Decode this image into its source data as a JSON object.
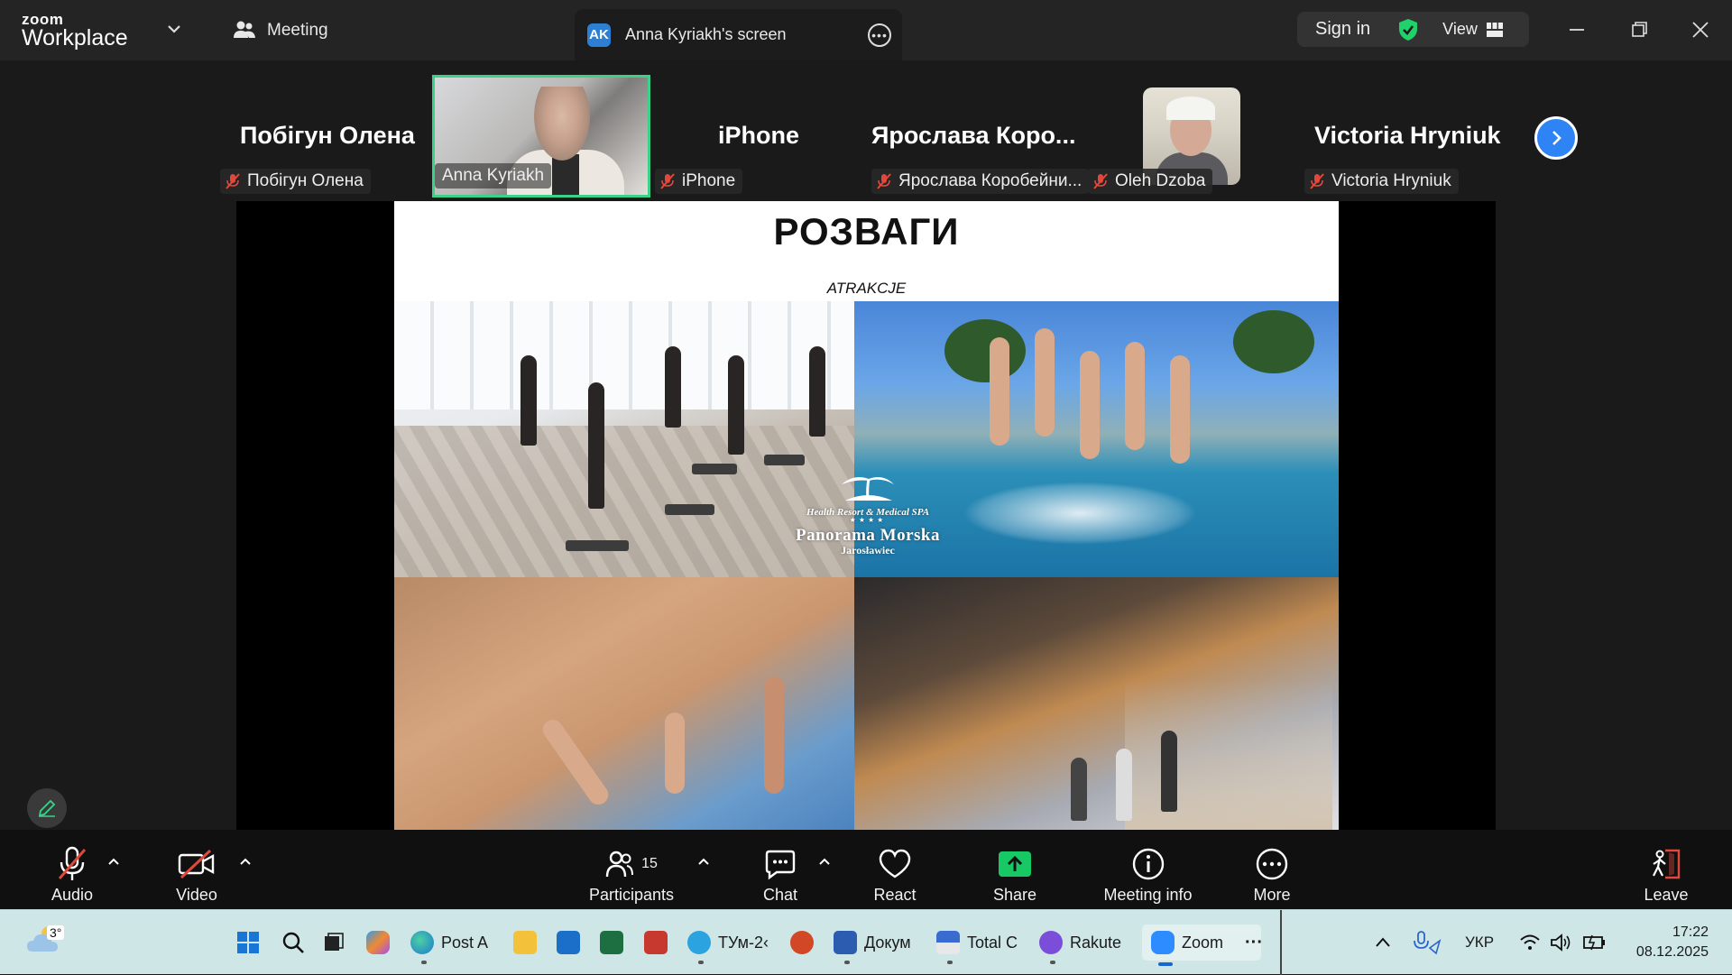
{
  "titlebar": {
    "logo_top": "zoom",
    "logo_bottom": "Workplace",
    "meeting_label": "Meeting",
    "screen_tab_initials": "AK",
    "screen_tab_title": "Anna Kyriakh's screen",
    "sign_in": "Sign in",
    "view": "View"
  },
  "participants": [
    {
      "display_name": "Побігун Олена",
      "label": "Побігун Олена"
    },
    {
      "display_name": "",
      "label": "Anna Kyriakh"
    },
    {
      "display_name": "iPhone",
      "label": "iPhone"
    },
    {
      "display_name": "Ярослава  Коро...",
      "label": "Ярослава Коробейни..."
    },
    {
      "display_name": "",
      "label": "Oleh Dzoba"
    },
    {
      "display_name": "Victoria Hryniuk",
      "label": "Victoria Hryniuk"
    }
  ],
  "slide": {
    "title": "РОЗВАГИ",
    "subtitle": "ATRAKCJE",
    "logo_line1": "Health Resort & Medical SPA",
    "logo_stars": "★★★★",
    "logo_line2": "Panorama Morska",
    "logo_line3": "Jarosławiec"
  },
  "toolbar": {
    "audio": "Audio",
    "video": "Video",
    "participants": "Participants",
    "participants_count": "15",
    "chat": "Chat",
    "react": "React",
    "share": "Share",
    "meeting_info": "Meeting info",
    "more": "More",
    "leave": "Leave"
  },
  "taskbar": {
    "weather_temp": "3°",
    "apps": [
      "Post A",
      "ТУм-2‹",
      "Докум",
      "Total C",
      "Rakute",
      "Zoom"
    ],
    "lang": "УКР",
    "time": "17:22",
    "date": "08.12.2025"
  },
  "colors": {
    "accent_green": "#3ad18a",
    "share_green": "#16c964",
    "zoom_blue": "#2e84f5",
    "mute_red": "#e0483c"
  }
}
